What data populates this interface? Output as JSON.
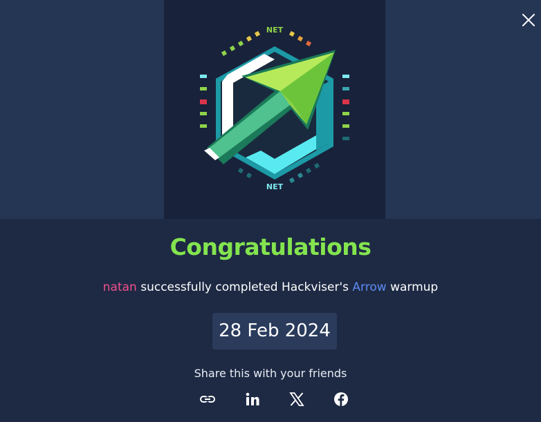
{
  "banner": {
    "art_label_top": "NET",
    "art_label_bottom": "NET"
  },
  "close": {
    "icon": "close-icon"
  },
  "title": "Congratulations",
  "subtitle": {
    "user": "natan",
    "middle": " successfully completed Hackviser's ",
    "machine": "Arrow",
    "end": " warmup"
  },
  "date": "28 Feb 2024",
  "share": {
    "label": "Share this with your friends",
    "icons": [
      "link-icon",
      "linkedin-icon",
      "x-icon",
      "facebook-icon"
    ]
  },
  "colors": {
    "background": "#1e2a44",
    "banner": "#253655",
    "title": "#84e44f",
    "user": "#f0508c",
    "machine": "#5c8cf2",
    "date_pill": "#2a3b5c"
  }
}
